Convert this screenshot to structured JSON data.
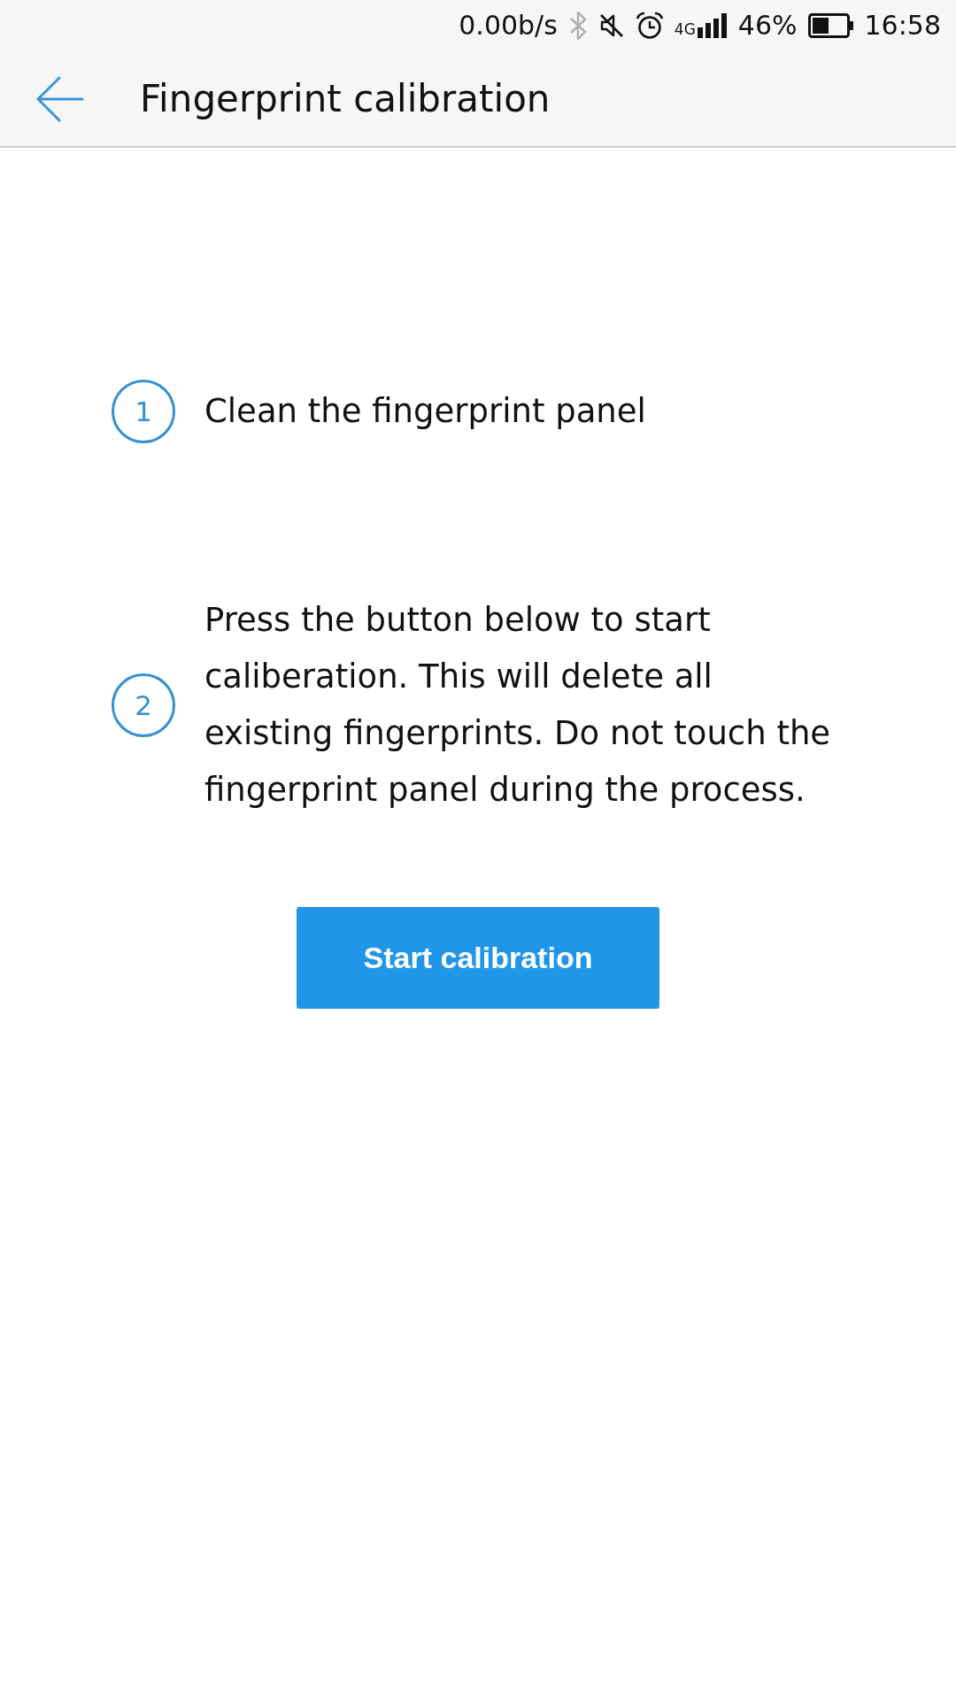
{
  "status_bar": {
    "network_speed": "0.00b/s",
    "network_type": "4G",
    "battery": "46%",
    "time": "16:58"
  },
  "header": {
    "title": "Fingerprint calibration"
  },
  "steps": [
    {
      "number": "1",
      "text": "Clean the fingerprint panel"
    },
    {
      "number": "2",
      "text": "Press the button below to start caliberation. This will delete all existing fingerprints. Do not touch the fingerprint panel during the process."
    }
  ],
  "button": {
    "label": "Start calibration"
  }
}
